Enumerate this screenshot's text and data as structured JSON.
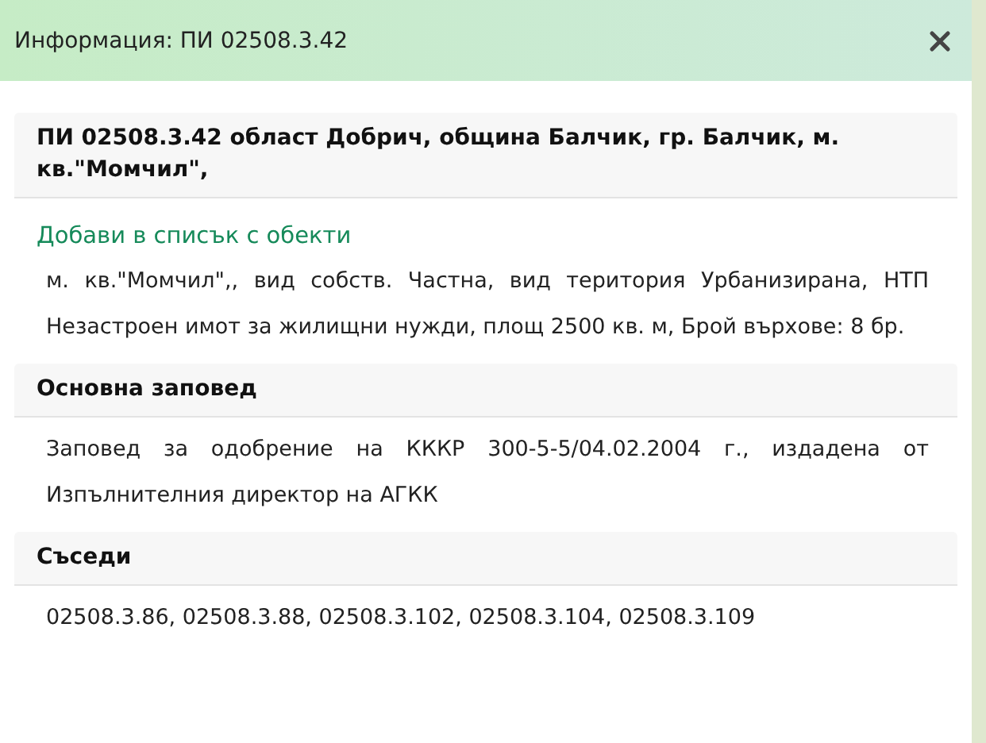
{
  "window": {
    "title": "Информация: ПИ 02508.3.42"
  },
  "parcel": {
    "heading": "ПИ 02508.3.42 област Добрич, община Балчик, гр. Балчик, м. кв.\"Момчил\",",
    "link": "Добави в списък с обекти",
    "description": "м. кв.\"Момчил\",, вид собств. Частна, вид територия Урбанизирана, НТП Незастроен имот за жилищни нужди, площ 2500 кв. м, Брой върхове: 8 бр."
  },
  "sections": [
    {
      "heading": "Основна заповед",
      "text": "Заповед за одобрение на КККР 300-5-5/04.02.2004 г., издадена от Изпълнителния директор на АГКК"
    },
    {
      "heading": "Съседи",
      "text": "02508.3.86, 02508.3.88, 02508.3.102, 02508.3.104, 02508.3.109"
    }
  ]
}
